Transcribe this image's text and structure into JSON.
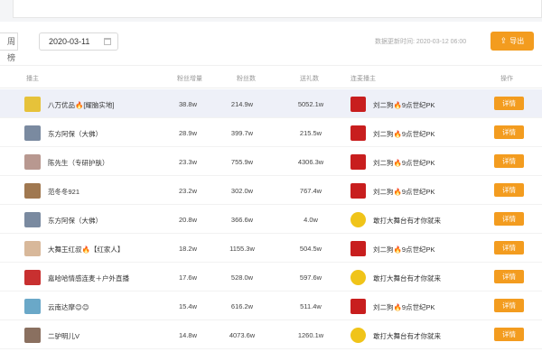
{
  "toolbar": {
    "week_tab": "周榜",
    "date_value": "2020-03-11",
    "update_label": "数据更新时间:",
    "update_value": "2020-03-12 06:00",
    "export_label": "导出",
    "export_icon": "upload-icon"
  },
  "columns": {
    "host": "播主",
    "fan_growth": "粉丝增量",
    "fans": "粉丝数",
    "gifts": "送礼数",
    "pk_host": "连麦播主",
    "actions": "操作"
  },
  "rows": [
    {
      "host": "八万优品🔥[耀脑实地]",
      "fan_growth": "38.8w",
      "fans": "214.9w",
      "gifts": "5052.1w",
      "pk_host": "刘二狗🔥9点世纪PK",
      "detail": "详情",
      "avatar_color": "#e6c23a",
      "pk_color": "#c81e1e",
      "pk_round": false
    },
    {
      "host": "东方阿保（大佛）",
      "fan_growth": "28.9w",
      "fans": "399.7w",
      "gifts": "215.5w",
      "pk_host": "刘二狗🔥9点世纪PK",
      "detail": "详情",
      "avatar_color": "#7a8aa0",
      "pk_color": "#c81e1e",
      "pk_round": false
    },
    {
      "host": "陈先生（专研护肤）",
      "fan_growth": "23.3w",
      "fans": "755.9w",
      "gifts": "4306.3w",
      "pk_host": "刘二狗🔥9点世纪PK",
      "detail": "详情",
      "avatar_color": "#b89890",
      "pk_color": "#c81e1e",
      "pk_round": false
    },
    {
      "host": "范冬冬921",
      "fan_growth": "23.2w",
      "fans": "302.0w",
      "gifts": "767.4w",
      "pk_host": "刘二狗🔥9点世纪PK",
      "detail": "详情",
      "avatar_color": "#a07850",
      "pk_color": "#c81e1e",
      "pk_round": false
    },
    {
      "host": "东方阿保（大佛）",
      "fan_growth": "20.8w",
      "fans": "366.6w",
      "gifts": "4.0w",
      "pk_host": "敢打大舞台有才你就来",
      "detail": "详情",
      "avatar_color": "#7a8aa0",
      "pk_color": "#f0c419",
      "pk_round": true
    },
    {
      "host": "大舞王红叔🔥【红家人】",
      "fan_growth": "18.2w",
      "fans": "1155.3w",
      "gifts": "504.5w",
      "pk_host": "刘二狗🔥9点世纪PK",
      "detail": "详情",
      "avatar_color": "#d8b89a",
      "pk_color": "#c81e1e",
      "pk_round": false
    },
    {
      "host": "嘉哈哈情感连麦＋户外直播",
      "fan_growth": "17.6w",
      "fans": "528.0w",
      "gifts": "597.6w",
      "pk_host": "敢打大舞台有才你就来",
      "detail": "详情",
      "avatar_color": "#c83030",
      "pk_color": "#f0c419",
      "pk_round": true
    },
    {
      "host": "云南达摩😊😊",
      "fan_growth": "15.4w",
      "fans": "616.2w",
      "gifts": "511.4w",
      "pk_host": "刘二狗🔥9点世纪PK",
      "detail": "详情",
      "avatar_color": "#6aa8c8",
      "pk_color": "#c81e1e",
      "pk_round": false
    },
    {
      "host": "二驴明儿V",
      "fan_growth": "14.8w",
      "fans": "4073.6w",
      "gifts": "1260.1w",
      "pk_host": "敢打大舞台有才你就来",
      "detail": "详情",
      "avatar_color": "#8a7060",
      "pk_color": "#f0c419",
      "pk_round": true
    }
  ],
  "colors": {
    "accent": "#f39c1f",
    "highlight_row": "#eef0f8"
  }
}
